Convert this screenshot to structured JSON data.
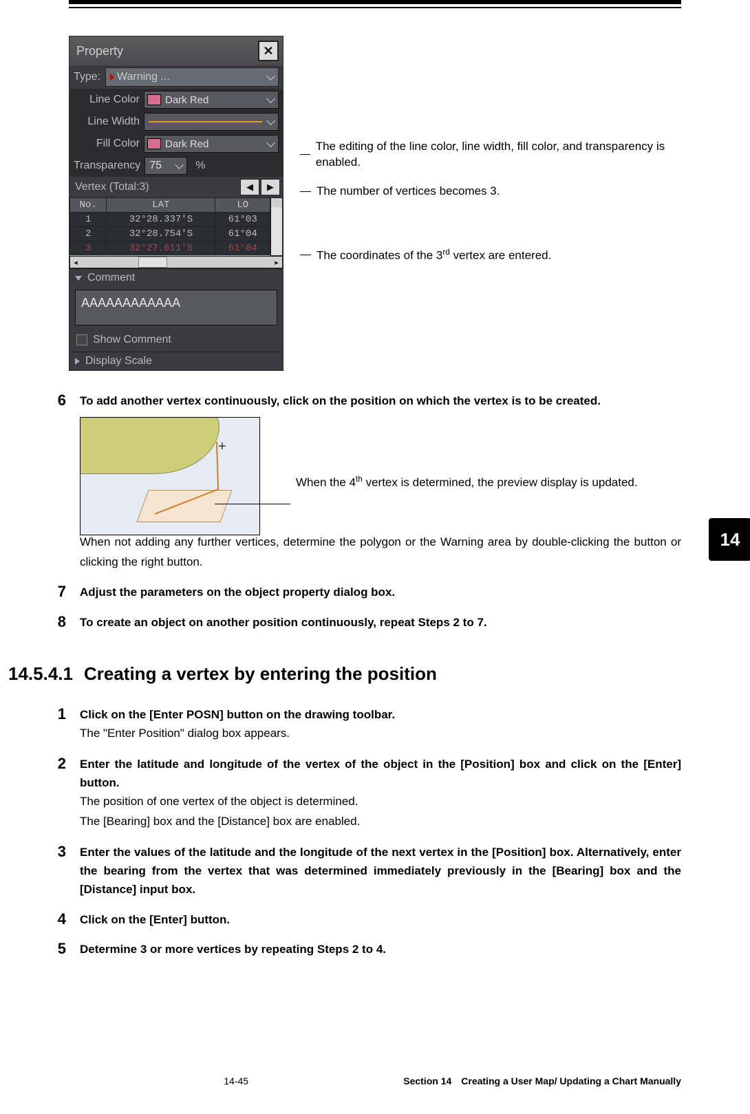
{
  "property_panel": {
    "title": "Property",
    "type_label": "Type:",
    "type_value": "Warning ...",
    "line_color_label": "Line Color",
    "line_color_value": "Dark Red",
    "line_width_label": "Line Width",
    "fill_color_label": "Fill Color",
    "fill_color_value": "Dark Red",
    "transparency_label": "Transparency",
    "transparency_value": "75",
    "transparency_unit": "%",
    "vertex_header": "Vertex (Total:3)",
    "table_headers": [
      "No.",
      "LAT",
      "LO"
    ],
    "vertices": [
      {
        "no": "1",
        "lat": "32°28.337'S",
        "lon": "61°03"
      },
      {
        "no": "2",
        "lat": "32°28.754'S",
        "lon": "61°04"
      },
      {
        "no": "3",
        "lat": "32°27.611'S",
        "lon": "61°04"
      }
    ],
    "comment_header": "Comment",
    "comment_value": "AAAAAAAAAAAA",
    "show_comment_label": "Show Comment",
    "display_scale_header": "Display Scale"
  },
  "annots": {
    "a1": "The editing of the line color, line width, fill color, and transparency is enabled.",
    "a2": "The number of vertices becomes 3.",
    "a3_pre": "The coordinates of the 3",
    "a3_sup": "rd",
    "a3_post": " vertex are entered."
  },
  "steps_top": {
    "s6_num": "6",
    "s6_txt": "To add another vertex continuously, click on the position on which the vertex is to be created.",
    "map_caption_pre": "When the 4",
    "map_caption_sup": "th",
    "map_caption_post": " vertex is determined, the preview display is updated.",
    "s6_para": "When not adding any further vertices, determine the polygon or the Warning area by double-clicking the button or clicking the right button.",
    "s7_num": "7",
    "s7_txt": "Adjust the parameters on the object property dialog box.",
    "s8_num": "8",
    "s8_txt": "To create an object on another position continuously, repeat Steps 2 to 7."
  },
  "heading": {
    "number": "14.5.4.1",
    "title": "Creating a vertex by entering the position"
  },
  "steps_bottom": {
    "s1_num": "1",
    "s1_bold": "Click on the [Enter POSN] button on the drawing toolbar.",
    "s1_txt": "The \"Enter Position\" dialog box appears.",
    "s2_num": "2",
    "s2_bold": "Enter the latitude and longitude of the vertex of the object in the [Position] box and click on the [Enter] button.",
    "s2_txt1": "The position of one vertex of the object is determined.",
    "s2_txt2": "The [Bearing] box and the [Distance] box are enabled.",
    "s3_num": "3",
    "s3_bold": "Enter the values of the latitude and the longitude of the next vertex in the [Position] box. Alternatively, enter the bearing from the vertex that was determined immediately previously in the [Bearing] box and the [Distance] input box.",
    "s4_num": "4",
    "s4_bold": "Click on the [Enter] button.",
    "s5_num": "5",
    "s5_bold": "Determine 3 or more vertices by repeating Steps 2 to 4."
  },
  "chapter_tab": "14",
  "footer": {
    "page": "14-45",
    "section": "Section 14 Creating a User Map/ Updating a Chart Manually"
  }
}
